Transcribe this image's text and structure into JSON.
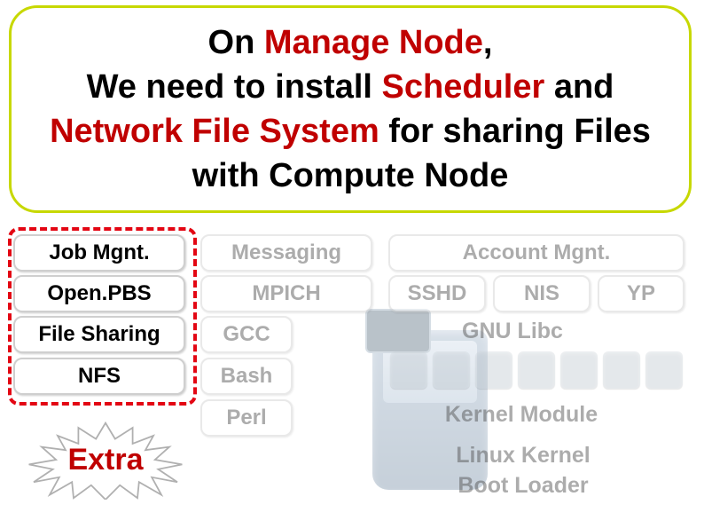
{
  "headline": {
    "p1": "On ",
    "p2": "Manage Node",
    "p3": ",",
    "p4": "We need to install ",
    "p5": "Scheduler",
    "p6": " and ",
    "p7": "Network File System",
    "p8": " for sharing Files with Compute Node"
  },
  "left": {
    "job_mgnt": "Job Mgnt.",
    "open_pbs": "Open.PBS",
    "file_sharing": "File Sharing",
    "nfs": "NFS"
  },
  "mid": {
    "messaging": "Messaging",
    "mpich": "MPICH",
    "gcc": "GCC",
    "bash": "Bash",
    "perl": "Perl"
  },
  "right": {
    "account_mgnt": "Account Mgnt.",
    "sshd": "SSHD",
    "nis": "NIS",
    "yp": "YP",
    "gnu_libc": "GNU Libc",
    "kernel_module": "Kernel Module",
    "linux_kernel": "Linux Kernel",
    "boot_loader": "Boot Loader"
  },
  "extra": "Extra",
  "colors": {
    "accent_red": "#c00000",
    "border_olive": "#c7d800"
  }
}
